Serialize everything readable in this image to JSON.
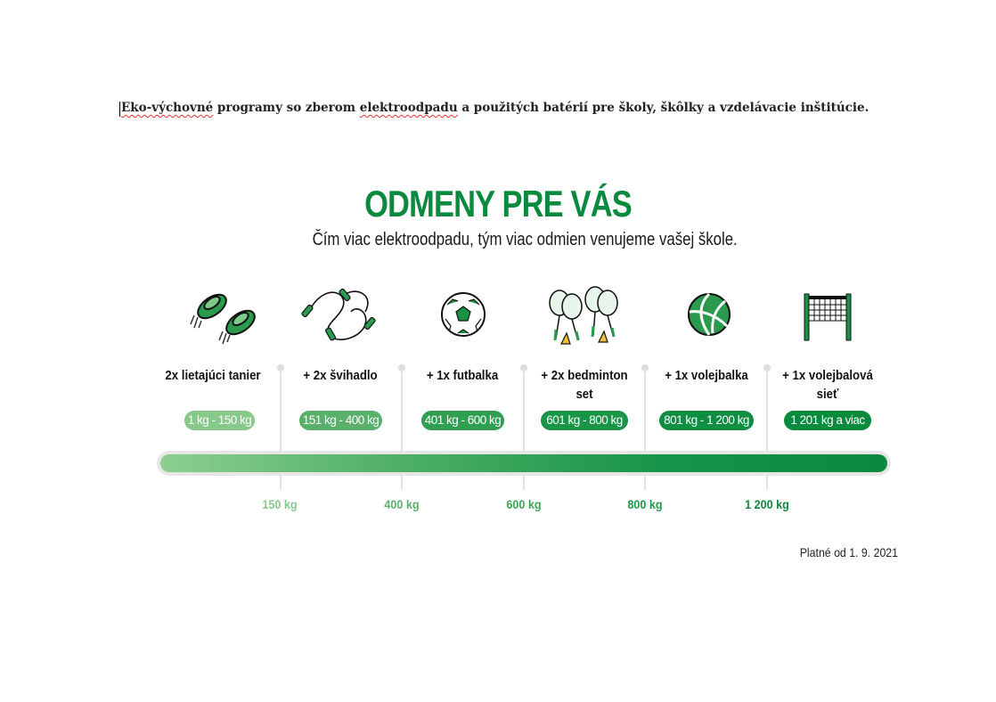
{
  "document": {
    "heading_parts": [
      "Eko-výchovné",
      " programy so zberom ",
      "elektroodpadu",
      " a použitých batérií pre školy, škôlky a vzdelávacie inštitúcie."
    ]
  },
  "infographic": {
    "title": "ODMENY PRE VÁS",
    "subtitle": "Čím viac elektroodpadu, tým viac odmien venujeme vašej škole.",
    "rewards": [
      {
        "label": "2x lietajúci tanier",
        "range": "1 kg - 150 kg",
        "icon": "flying-disc-icon"
      },
      {
        "label": "+ 2x švihadlo",
        "range": "151 kg - 400 kg",
        "icon": "jump-rope-icon"
      },
      {
        "label": "+ 1x futbalka",
        "range": "401 kg - 600 kg",
        "icon": "soccer-ball-icon"
      },
      {
        "label": "+ 2x bedminton set",
        "range": "601 kg - 800 kg",
        "icon": "badminton-set-icon"
      },
      {
        "label": "+ 1x volejbalka",
        "range": "801 kg - 1 200 kg",
        "icon": "volleyball-icon"
      },
      {
        "label": "+ 1x volejbalová sieť",
        "range": "1 201 kg a viac",
        "icon": "volleyball-net-icon"
      }
    ],
    "thresholds": [
      "150 kg",
      "400 kg",
      "600 kg",
      "800 kg",
      "1 200 kg"
    ],
    "validity": "Platné od 1. 9. 2021",
    "colors": {
      "brand_green": "#0a8a3e",
      "pills": [
        "#86c98a",
        "#5ab06a",
        "#2f9e52",
        "#1a9447",
        "#0f8e43",
        "#0a8a3e"
      ],
      "ticks": [
        "#86c98a",
        "#5ab06a",
        "#3aa556",
        "#1e9a4a",
        "#0a8a3e"
      ]
    }
  }
}
